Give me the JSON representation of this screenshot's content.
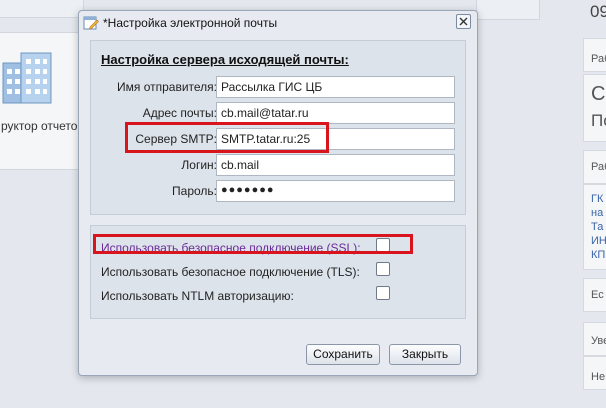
{
  "background": {
    "left_tile_label": "руктор отчето",
    "right_column": {
      "clock_text": "09",
      "block1_text": "Раб",
      "block2_line1": "С",
      "block2_line2": "По",
      "block3_text": "Раб",
      "block3_links": [
        "ГК",
        "на",
        "Та",
        "ИН",
        "КП"
      ],
      "block4_text": "Ес",
      "block5_text": "Уве",
      "block6_text": "Не"
    }
  },
  "dialog": {
    "title": "*Настройка электронной почты",
    "server_section": {
      "legend": "Настройка сервера исходящей почты:",
      "fields": [
        {
          "label": "Имя отправителя:",
          "value": "Рассылка ГИС ЦБ"
        },
        {
          "label": "Адрес почты:",
          "value": "cb.mail@tatar.ru"
        },
        {
          "label": "Сервер SMTP:",
          "value": "SMTP.tatar.ru:25"
        },
        {
          "label": "Логин:",
          "value": "cb.mail"
        },
        {
          "label": "Пароль:",
          "value": "●●●●●●●"
        }
      ]
    },
    "options": [
      {
        "label": "Использовать безопасное подключение (SSL):",
        "checked": false
      },
      {
        "label": "Использовать безопасное подключение (TLS):",
        "checked": false
      },
      {
        "label": "Использовать NTLM авторизацию:",
        "checked": false
      }
    ],
    "buttons": {
      "save": "Сохранить",
      "close": "Закрыть"
    }
  },
  "colors": {
    "highlight": "#d8141c",
    "ssl_label": "#6a2a96",
    "dialog_background": "#e7ebf1",
    "fieldset_background": "#dde3eb"
  },
  "icons": {
    "title": "edit-window-icon",
    "close": "close-icon",
    "background_tile": "building-report-icon"
  }
}
